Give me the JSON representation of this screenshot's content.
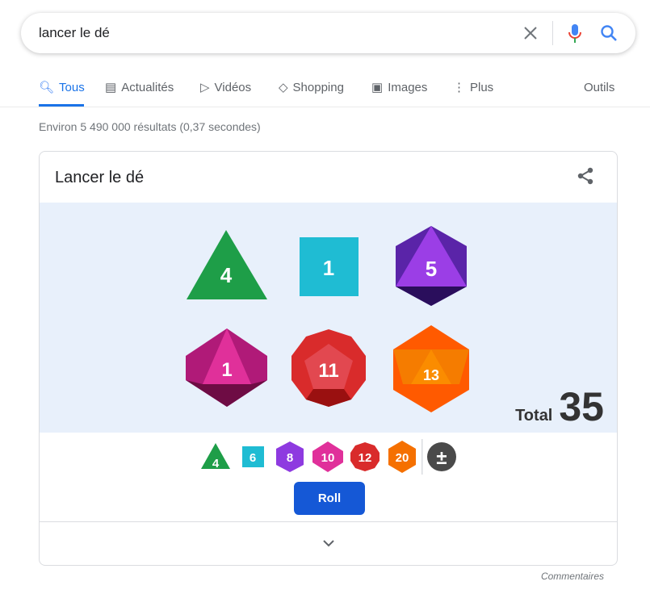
{
  "search": {
    "query": "lancer le dé"
  },
  "tabs": [
    {
      "label": "Tous",
      "icon": "search-icon"
    },
    {
      "label": "Actualités",
      "icon": "news-icon"
    },
    {
      "label": "Vidéos",
      "icon": "video-icon"
    },
    {
      "label": "Shopping",
      "icon": "tag-icon"
    },
    {
      "label": "Images",
      "icon": "image-icon"
    },
    {
      "label": "Plus",
      "icon": "more-vert-icon"
    }
  ],
  "tools_label": "Outils",
  "stats": "Environ 5 490 000 résultats (0,37 secondes)",
  "card": {
    "title": "Lancer le dé",
    "results": [
      {
        "die": "d4",
        "value": "4",
        "color": "#1e9e48"
      },
      {
        "die": "d6",
        "value": "1",
        "color": "#1fbcd3"
      },
      {
        "die": "d8",
        "value": "5",
        "color": "#8e3ae0"
      },
      {
        "die": "d10",
        "value": "1",
        "color": "#e0309a"
      },
      {
        "die": "d12",
        "value": "11",
        "color": "#d92b2b"
      },
      {
        "die": "d20",
        "value": "13",
        "color": "#f57000"
      }
    ],
    "total_label": "Total",
    "total_value": "35",
    "chips": [
      "4",
      "6",
      "8",
      "10",
      "12",
      "20"
    ],
    "modifier": "±",
    "roll_label": "Roll"
  },
  "feedback": "Commentaires"
}
